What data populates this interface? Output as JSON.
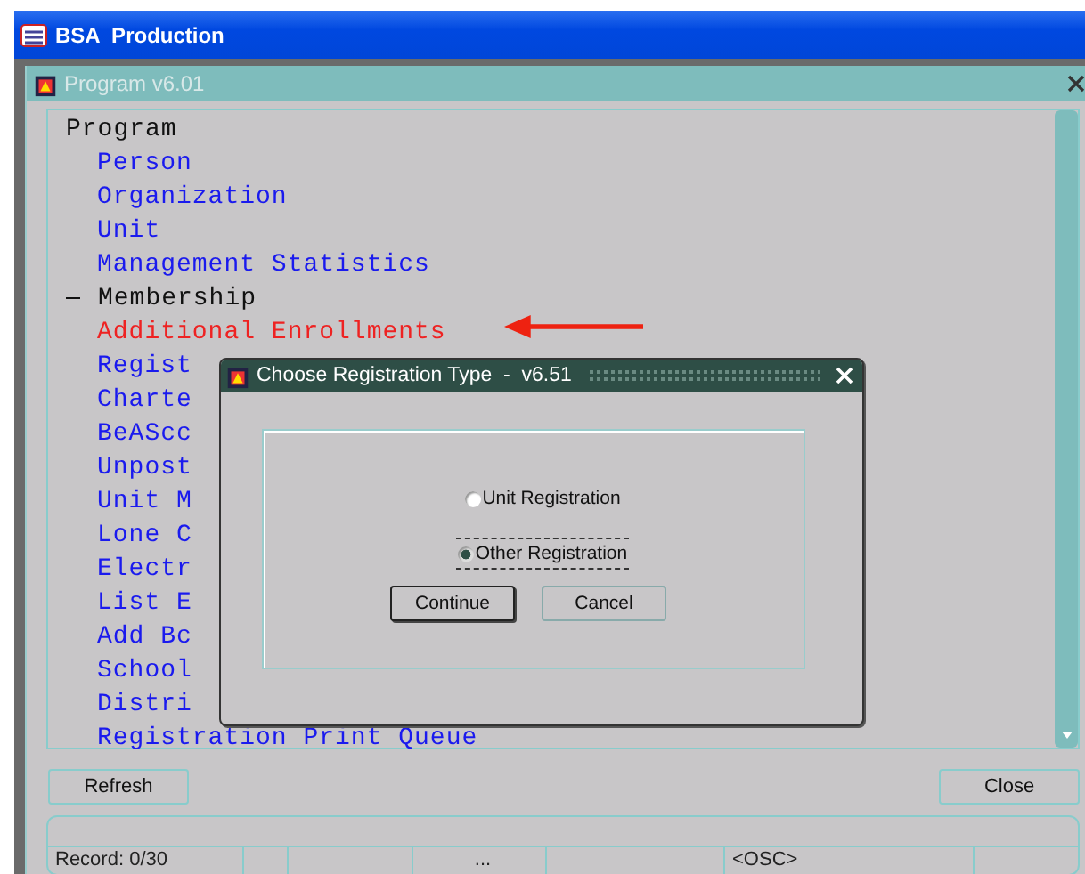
{
  "window": {
    "title": "BSA  Production"
  },
  "program_window": {
    "title": "Program v6.01"
  },
  "tree": [
    {
      "label": "Program",
      "selected": false,
      "children": [
        {
          "label": "Person",
          "selected": false
        },
        {
          "label": "Organization",
          "selected": false
        },
        {
          "label": "Unit",
          "selected": false
        },
        {
          "label": "Management Statistics",
          "selected": false
        }
      ]
    },
    {
      "label": "Membership",
      "selected": false,
      "expanded": true,
      "children": [
        {
          "label": "Additional Enrollments",
          "selected": true
        },
        {
          "label": "Regist",
          "selected": false
        },
        {
          "label": "Charte",
          "selected": false
        },
        {
          "label": "BeAScc",
          "selected": false
        },
        {
          "label": "Unpost",
          "selected": false
        },
        {
          "label": "Unit M",
          "selected": false
        },
        {
          "label": "Lone C",
          "selected": false
        },
        {
          "label": "Electr",
          "selected": false
        },
        {
          "label": "List E",
          "selected": false
        },
        {
          "label": "Add Bc",
          "selected": false
        },
        {
          "label": "School",
          "selected": false
        },
        {
          "label": "Distri",
          "selected": false
        },
        {
          "label": "Registration Print Queue",
          "selected": false
        }
      ]
    }
  ],
  "buttons": [
    "Refresh",
    "Close"
  ],
  "status_bar": [
    "Record: 0/30",
    "...",
    "<OSC>"
  ],
  "dialog": {
    "title": "Choose Registration Type  -  v6.51",
    "options": [
      {
        "label": "Unit Registration",
        "selected": false,
        "focused": false
      },
      {
        "label": "Other Registration",
        "selected": true,
        "focused": true
      }
    ],
    "buttons": [
      {
        "label": "Continue",
        "default": true
      },
      {
        "label": "Cancel",
        "default": false
      }
    ]
  }
}
